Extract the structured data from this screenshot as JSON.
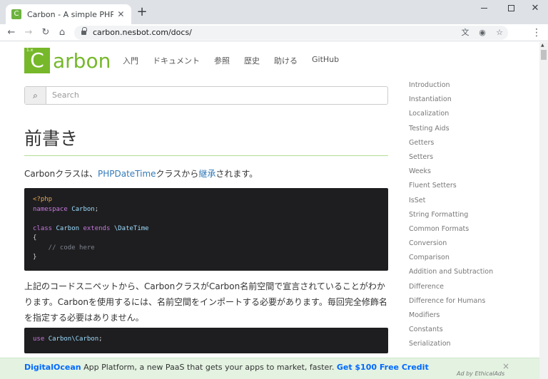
{
  "browser": {
    "tab_title": "Carbon - A simple PHP API extension for DateTime",
    "tab_favicon_letter": "C",
    "new_tab": "+",
    "url": "carbon.nesbot.com/docs/"
  },
  "header": {
    "logo_mark": "C",
    "logo_mark_small": "1.x",
    "logo_text": "arbon",
    "nav": [
      "入門",
      "ドキュメント",
      "参照",
      "歴史",
      "助ける",
      "GitHub"
    ]
  },
  "search": {
    "placeholder": "Search"
  },
  "main": {
    "title": "前書き",
    "intro_before": "Carbonクラスは、",
    "intro_link1": "PHPDateTime",
    "intro_middle": "クラスから",
    "intro_link2": "継承",
    "intro_after": "されます。",
    "code1": {
      "line1": "<?php",
      "line2_kw": "namespace",
      "line2_ns": "Carbon",
      "line2_end": ";",
      "line4_kw1": "class",
      "line4_name": "Carbon",
      "line4_kw2": "extends",
      "line4_parent": "\\DateTime",
      "line5": "{",
      "line6": "    // code here",
      "line7": "}"
    },
    "para2": "上記のコードスニペットから、CarbonクラスがCarbon名前空間で宣言されていることがわかります。Carbonを使用するには、名前空間をインポートする必要があります。毎回完全修飾名を指定する必要はありません。",
    "code2": {
      "kw": "use",
      "ns": "Carbon\\Carbon",
      "end": ";"
    }
  },
  "sidebar": {
    "items": [
      "Introduction",
      "Instantiation",
      "Localization",
      "Testing Aids",
      "Getters",
      "Setters",
      "Weeks",
      "Fluent Setters",
      "IsSet",
      "String Formatting",
      "Common Formats",
      "Conversion",
      "Comparison",
      "Addition and Subtraction",
      "Difference",
      "Difference for Humans",
      "Modifiers",
      "Constants",
      "Serialization"
    ]
  },
  "ad": {
    "brand": "DigitalOcean",
    "text": " App Platform, a new PaaS that gets your apps to market, faster. ",
    "cta": "Get $100 Free Credit",
    "by": "Ad by EthicalAds",
    "close": "×"
  }
}
